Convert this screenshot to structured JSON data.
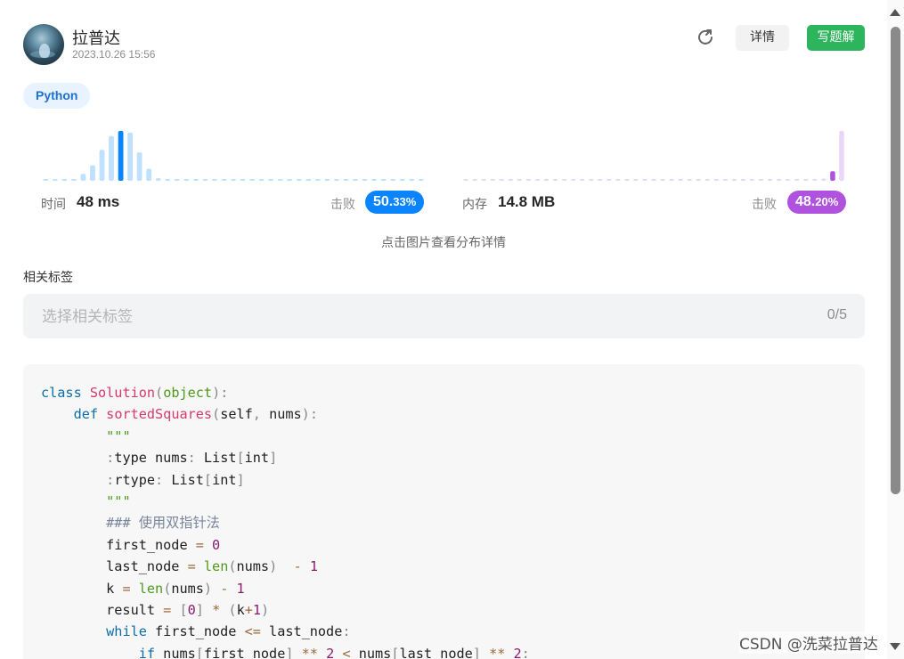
{
  "header": {
    "username": "拉普达",
    "date": "2023.10.26 15:56",
    "detail_label": "详情",
    "write_label": "写题解"
  },
  "language_tag": "Python",
  "stats": {
    "time_label": "时间",
    "time_value": "48 ms",
    "beat_label": "击败",
    "time_beat_main": "50.",
    "time_beat_frac": "33%",
    "memory_label": "内存",
    "memory_value": "14.8 MB",
    "memory_beat_main": "48.",
    "memory_beat_frac": "20%"
  },
  "chart_data": [
    {
      "type": "bar",
      "series_color": "#0a84ff",
      "values": [
        1,
        1,
        1,
        1,
        8,
        18,
        36,
        52,
        58,
        56,
        33,
        14,
        3,
        1,
        1,
        1,
        1,
        1,
        1,
        1,
        1,
        1,
        1,
        1,
        1,
        1,
        1,
        1,
        1,
        1,
        1,
        1,
        1,
        1,
        1,
        1,
        1,
        1,
        1,
        1,
        1
      ],
      "highlight_index": 8
    },
    {
      "type": "bar",
      "series_color": "#af52de",
      "values": [
        1,
        1,
        1,
        1,
        1,
        1,
        1,
        1,
        1,
        1,
        1,
        1,
        1,
        1,
        1,
        1,
        1,
        1,
        1,
        1,
        1,
        1,
        1,
        1,
        1,
        1,
        1,
        1,
        1,
        1,
        1,
        1,
        1,
        1,
        1,
        1,
        1,
        1,
        1,
        1,
        2,
        9,
        47
      ],
      "highlight_index": 41
    }
  ],
  "hint": "点击图片查看分布详情",
  "tags": {
    "title": "相关标签",
    "placeholder": "选择相关标签",
    "count": "0/5"
  },
  "code": {
    "language": "python",
    "lines": [
      "class Solution(object):",
      "    def sortedSquares(self, nums):",
      "        \"\"\"",
      "        :type nums: List[int]",
      "        :rtype: List[int]",
      "        \"\"\"",
      "        ### 使用双指针法",
      "        first_node = 0",
      "        last_node = len(nums)  - 1",
      "        k = len(nums) - 1",
      "        result = [0] * (k+1)",
      "        while first_node <= last_node:",
      "            if nums[first_node] ** 2 < nums[last_node] ** 2:"
    ]
  },
  "watermark": "CSDN @洗菜拉普达"
}
